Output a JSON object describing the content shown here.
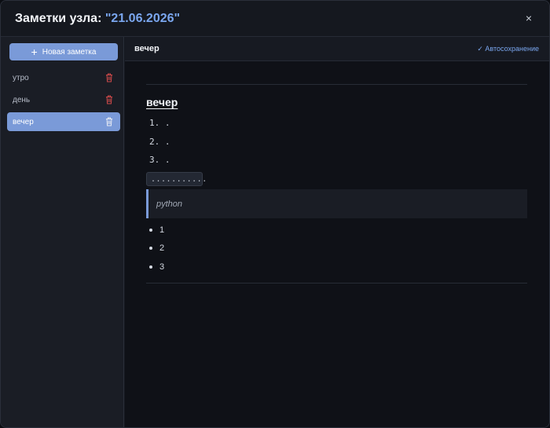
{
  "modal": {
    "title_prefix": "Заметки узла: ",
    "title_value": "\"21.06.2026\"",
    "close_label": "×"
  },
  "sidebar": {
    "new_note_label": "Новая заметка",
    "items": [
      {
        "label": "утро",
        "active": false
      },
      {
        "label": "день",
        "active": false
      },
      {
        "label": "вечер",
        "active": true
      }
    ]
  },
  "editor": {
    "note_title": "вечер",
    "autosave_label": "✓ Автосохранение",
    "heading": "вечер",
    "ordered_items": [
      "1. .",
      "2. .",
      "3. ."
    ],
    "inline_code": "...........",
    "quote": "python",
    "bullets": [
      "1",
      "2",
      "3"
    ]
  },
  "colors": {
    "accent": "#7a9ad8",
    "title_highlight": "#7aa6ee",
    "trash_red": "#d24a4a"
  }
}
